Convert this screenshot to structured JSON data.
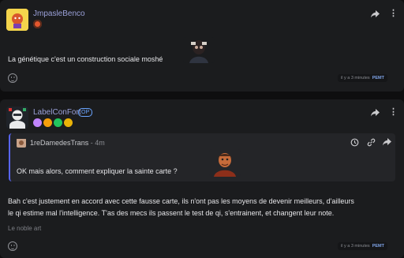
{
  "post1": {
    "username": "JmpasleBenco",
    "message": "La génétique c'est un construction sociale moshé",
    "timestamp": "il y a 3 minutes",
    "permalink": "PEMT",
    "badge_colors": [
      "#e4572e"
    ]
  },
  "post2": {
    "username": "LabelConFort",
    "op_badge": "OP",
    "badge_colors": [
      "#c084fc",
      "#f59e0b",
      "#22c55e",
      "#eab308"
    ],
    "quote": {
      "author": "1reDamedesTrans",
      "ago": "- 4m",
      "text": "OK mais alors, comment expliquer la sainte carte ?"
    },
    "message_line1": "Bah c'est justement en accord avec cette fausse carte, ils n'ont pas les moyens de devenir meilleurs, d'ailleurs",
    "message_line2": "le qi estime mal l'intelligence. T'as des mecs ils passent le test de qi, s'entrainent, et changent leur note.",
    "signature": "Le noble art",
    "timestamp": "il y a 3 minutes",
    "permalink": "PEMT"
  },
  "icons": {
    "share": "share-icon",
    "more": "kebab-menu-icon",
    "emoji": "add-reaction-icon",
    "history": "history-icon",
    "link": "link-icon"
  }
}
